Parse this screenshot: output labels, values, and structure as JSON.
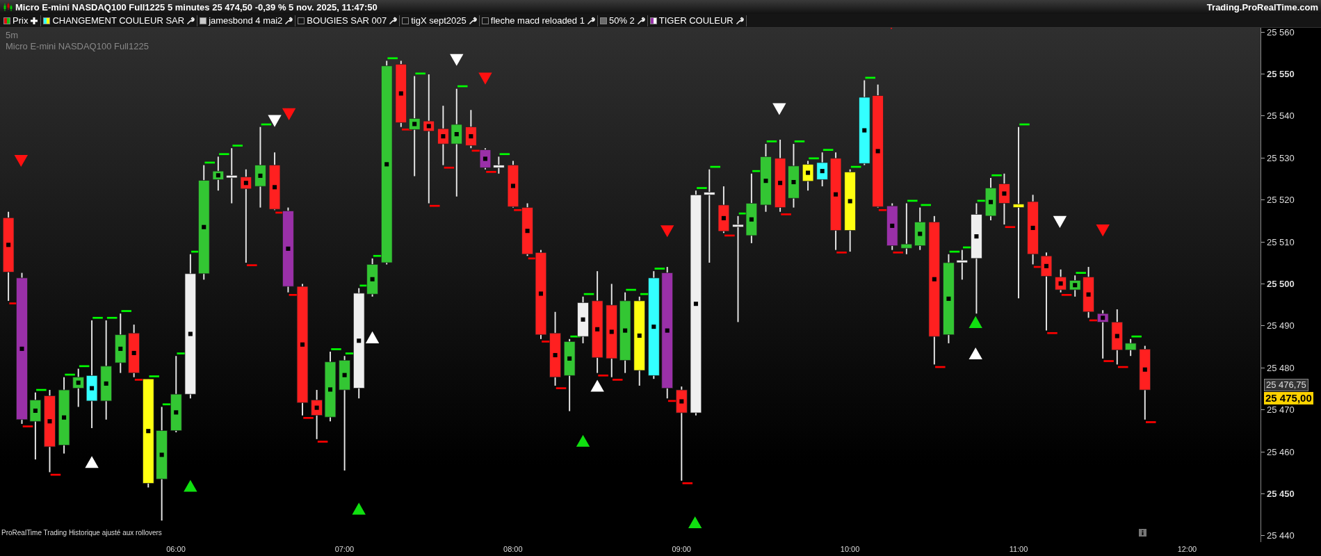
{
  "title_bar": {
    "title": "Micro E-mini NASDAQ100 Full1225 5 minutes 25 474,50 -0,39 % 5 nov. 2025, 11:47:50",
    "site": "Trading.ProRealTime.com"
  },
  "indicators": [
    {
      "label": "Prix",
      "swatch": {
        "kind": "pair",
        "parts": [
          {
            "color": "#e01010"
          },
          {
            "color": "#10c010"
          }
        ]
      },
      "tool": {
        "kind": "add"
      }
    },
    {
      "label": "CHANGEMENT COULEUR SAR",
      "swatch": {
        "kind": "pair",
        "parts": [
          {
            "color": "#33ffff"
          },
          {
            "color": "#ffff00"
          }
        ]
      },
      "tool": {
        "kind": "settings"
      }
    },
    {
      "label": "jamesbond 4 mai2",
      "swatch": {
        "kind": "solid",
        "parts": [
          {
            "color": "#c8c8c8"
          }
        ]
      },
      "tool": {
        "kind": "settings"
      }
    },
    {
      "label": "BOUGIES SAR 007",
      "swatch": {
        "kind": "empty"
      },
      "tool": {
        "kind": "settings"
      }
    },
    {
      "label": "tigX sept2025",
      "swatch": {
        "kind": "empty"
      },
      "tool": {
        "kind": "settings"
      }
    },
    {
      "label": "fleche macd reloaded 1",
      "swatch": {
        "kind": "empty"
      },
      "tool": {
        "kind": "settings"
      }
    },
    {
      "label": "50% 2",
      "swatch": {
        "kind": "solid",
        "parts": [
          {
            "color": "#6a6a6a"
          }
        ]
      },
      "tool": {
        "kind": "settings"
      }
    },
    {
      "label": "TIGER COULEUR",
      "swatch": {
        "kind": "pair",
        "parts": [
          {
            "color": "#9933aa"
          },
          {
            "color": "#ffffff"
          }
        ]
      },
      "tool": {
        "kind": "settings"
      }
    }
  ],
  "chart": {
    "timeframe": "5m",
    "instrument": "Micro E-mini NASDAQ100 Full1225",
    "footer": "ProRealTime Trading  Historique ajusté aux rollovers"
  },
  "y_axis": [
    {
      "label": "25 560",
      "emphasized": false
    },
    {
      "label": "25 550",
      "emphasized": true
    },
    {
      "label": "25 540",
      "emphasized": false
    },
    {
      "label": "25 530",
      "emphasized": false
    },
    {
      "label": "25 520",
      "emphasized": false
    },
    {
      "label": "25 510",
      "emphasized": false
    },
    {
      "label": "25 500",
      "emphasized": true
    },
    {
      "label": "25 490",
      "emphasized": false
    },
    {
      "label": "25 480",
      "emphasized": false
    },
    {
      "label": "25 470",
      "emphasized": false
    },
    {
      "label": "25 460",
      "emphasized": false
    },
    {
      "label": "25 450",
      "emphasized": true
    },
    {
      "label": "25 440",
      "emphasized": false
    }
  ],
  "price_labels": [
    {
      "text": "25 476,75",
      "kind": "last"
    },
    {
      "text": "25 475,00",
      "kind": "current"
    }
  ],
  "x_axis": [
    "06:00",
    "07:00",
    "08:00",
    "09:00",
    "10:00",
    "11:00",
    "12:00"
  ]
}
